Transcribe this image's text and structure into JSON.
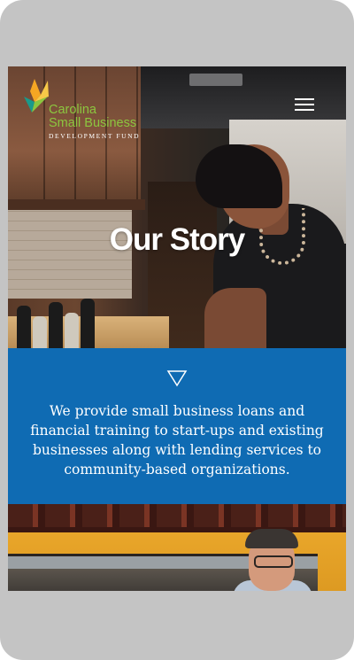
{
  "logo": {
    "line1": "Carolina",
    "line2": "Small Business",
    "line3": "DEVELOPMENT FUND",
    "colors": {
      "green": "#8cc63f",
      "orange": "#f5a623",
      "teal": "#1a9a8a"
    }
  },
  "header": {
    "menu_icon": "hamburger-menu-icon"
  },
  "hero": {
    "title": "Our Story"
  },
  "mission": {
    "icon": "down-triangle-icon",
    "text": "We provide small business loans and financial training to start-ups and existing businesses along with lending services to community-based organizations.",
    "background": "#0f6bb3"
  }
}
